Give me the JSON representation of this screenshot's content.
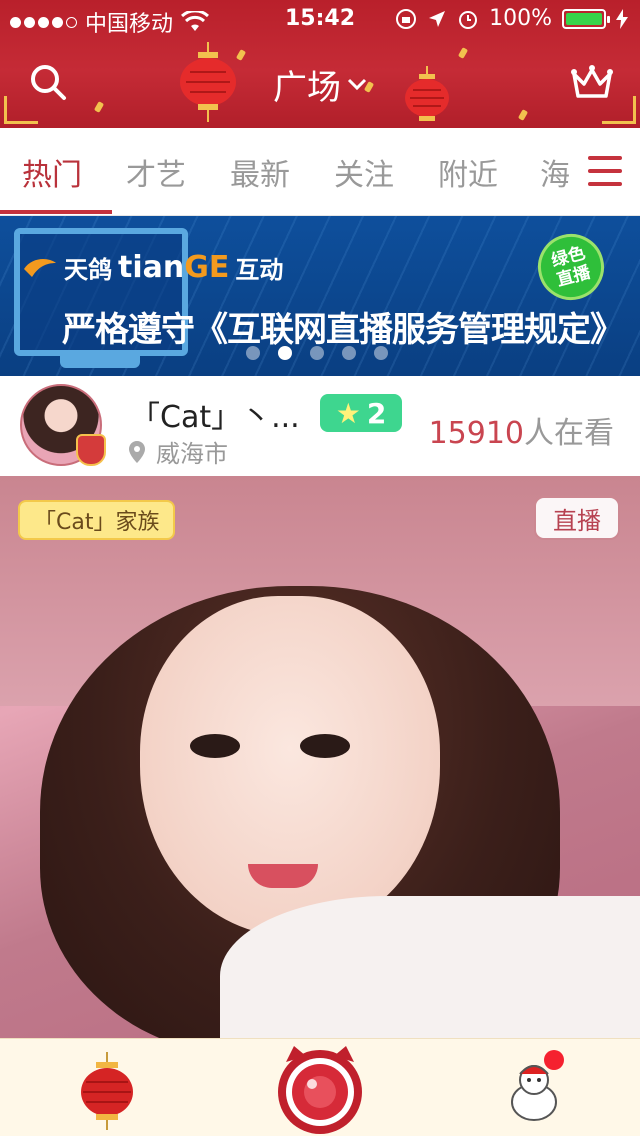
{
  "status_bar": {
    "carrier": "中国移动",
    "time": "15:42",
    "battery_percent": "100%",
    "battery_level": 1.0,
    "signal_bars_filled": 4,
    "signal_bars_total": 5
  },
  "header": {
    "title": "广场"
  },
  "tabs": [
    {
      "label": "热门",
      "active": true
    },
    {
      "label": "才艺",
      "active": false
    },
    {
      "label": "最新",
      "active": false
    },
    {
      "label": "关注",
      "active": false
    },
    {
      "label": "附近",
      "active": false
    },
    {
      "label": "海",
      "active": false
    }
  ],
  "banner": {
    "brand_cn": "天鸽",
    "brand_en_a": "tian",
    "brand_en_b": "GE",
    "brand_cn2": "互动",
    "headline": "严格遵守《互联网直播服务管理规定》",
    "badge_line1": "绿色",
    "badge_line2": "直播",
    "slide_count": 5,
    "active_slide": 2
  },
  "streamer": {
    "name": "「Cat」丶...",
    "level": "2",
    "location": "威海市",
    "viewer_count": "15910",
    "viewer_suffix": "人在看"
  },
  "cover": {
    "family_tag": "「Cat」家族",
    "live_badge": "直播"
  },
  "colors": {
    "header_red": "#b9202b",
    "tab_active": "#b9323b",
    "banner_blue": "#0e4f9c",
    "level_green": "#3ed68f",
    "viewer_count": "#c94550"
  },
  "icons": {
    "search": "search-icon",
    "crown": "crown-icon",
    "menu": "hamburger-menu-icon",
    "location": "location-pin-icon",
    "lantern": "lantern-icon",
    "camera": "camera-icon",
    "profile": "profile-mascot-icon"
  }
}
